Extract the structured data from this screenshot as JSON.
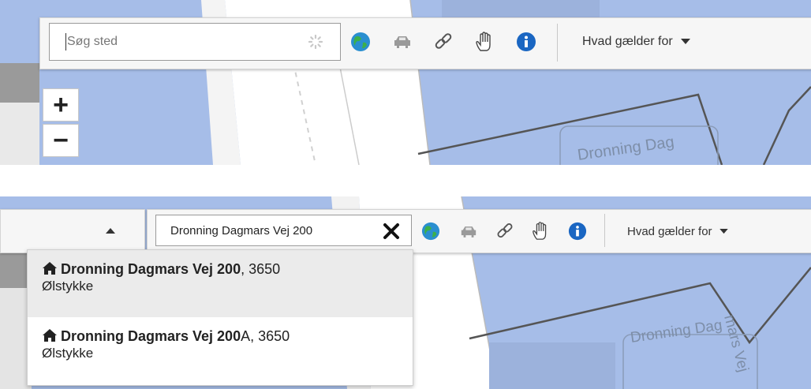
{
  "top_view": {
    "search": {
      "placeholder": "Søg sted"
    },
    "tools": [
      {
        "name": "globe-icon"
      },
      {
        "name": "car-icon"
      },
      {
        "name": "link-icon"
      },
      {
        "name": "hand-icon"
      },
      {
        "name": "info-icon"
      }
    ],
    "applies_dropdown_label": "Hvad gælder for",
    "zoom": {
      "in": "+",
      "out": "−"
    },
    "map_street_label": "Dronning Dag"
  },
  "bottom_view": {
    "search": {
      "value": "Dronning Dagmars Vej 200"
    },
    "applies_dropdown_label": "Hvad gælder for",
    "map_street_label": "Dronning Dag",
    "map_street_label_vertical": "mars Vej",
    "results": [
      {
        "match": "Dronning Dagmars Vej 200",
        "rest": ", 3650",
        "city": "Ølstykke"
      },
      {
        "match": "Dronning Dagmars Vej 200",
        "rest": "A, 3650",
        "city": "Ølstykke"
      }
    ]
  },
  "colors": {
    "map_water": "#a6bde8",
    "road": "#ffffff",
    "road_outline": "#cfcfcf",
    "toolbar": "#f6f6f6",
    "globe": "#2a8fd0",
    "info": "#1a66c2",
    "highlight_row": "#ebebeb"
  }
}
